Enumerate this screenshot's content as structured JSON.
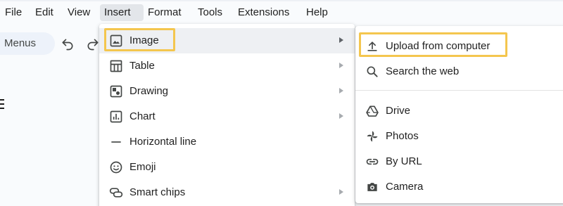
{
  "menubar": {
    "items": [
      "File",
      "Edit",
      "View",
      "Insert",
      "Format",
      "Tools",
      "Extensions",
      "Help"
    ],
    "active": "Insert"
  },
  "toolbar": {
    "menus_label": "Menus",
    "icons": [
      "undo-icon",
      "redo-icon"
    ]
  },
  "insert_menu": {
    "items": [
      {
        "label": "Image",
        "icon": "image-icon",
        "submenu": true
      },
      {
        "label": "Table",
        "icon": "table-icon",
        "submenu": true
      },
      {
        "label": "Drawing",
        "icon": "drawing-icon",
        "submenu": true
      },
      {
        "label": "Chart",
        "icon": "chart-icon",
        "submenu": true
      },
      {
        "label": "Horizontal line",
        "icon": "horizontal-line-icon",
        "submenu": false
      },
      {
        "label": "Emoji",
        "icon": "emoji-icon",
        "submenu": false
      },
      {
        "label": "Smart chips",
        "icon": "smart-chips-icon",
        "submenu": true
      }
    ]
  },
  "image_submenu": {
    "items": [
      {
        "label": "Upload from computer",
        "icon": "upload-icon"
      },
      {
        "label": "Search the web",
        "icon": "search-icon"
      },
      {
        "label": "Drive",
        "icon": "drive-icon"
      },
      {
        "label": "Photos",
        "icon": "photos-icon"
      },
      {
        "label": "By URL",
        "icon": "link-icon"
      },
      {
        "label": "Camera",
        "icon": "camera-icon"
      }
    ]
  },
  "colors": {
    "highlight": "#f4c64e",
    "hover": "#eef0f3",
    "menu_bg": "#ffffff",
    "text": "#1f1f1f",
    "icon": "#444746"
  }
}
